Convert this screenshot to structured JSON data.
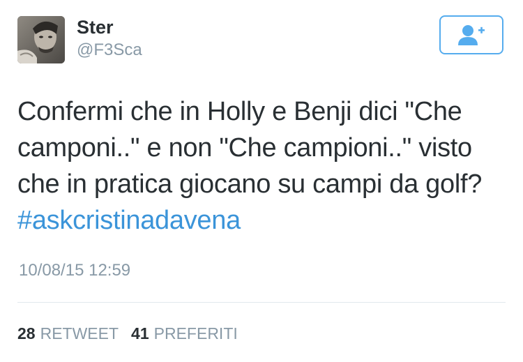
{
  "user": {
    "name": "Ster",
    "handle": "@F3Sca"
  },
  "follow_button": {
    "icon": "add-user-icon",
    "color": "#55acee"
  },
  "tweet": {
    "text_before_hashtag": "Confermi che in Holly e Benji dici \"Che camponi..\" e non \"Che campioni..\" visto che in pratica giocano su campi da golf? ",
    "hashtag": "#askcristinadavena",
    "timestamp": "10/08/15 12:59"
  },
  "stats": {
    "retweet_count": "28",
    "retweet_label": "RETWEET",
    "favorite_count": "41",
    "favorite_label": "PREFERITI"
  },
  "colors": {
    "text": "#292f33",
    "secondary": "#8899a6",
    "link": "#3b94d9",
    "divider": "#e1e8ed"
  }
}
